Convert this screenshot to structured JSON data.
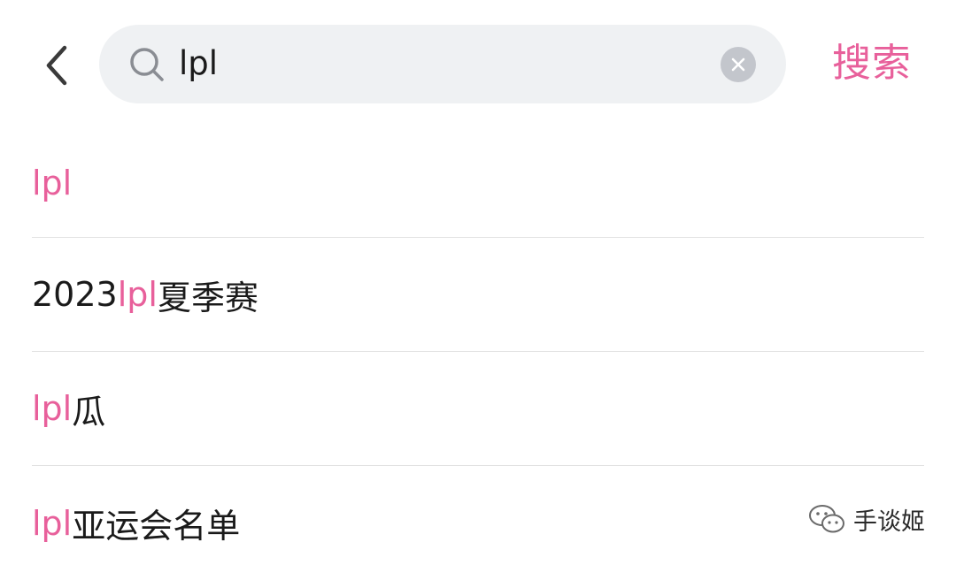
{
  "header": {
    "search_query": "lpl",
    "search_button_label": "搜索",
    "back_icon": "chevron-left-icon",
    "search_icon": "search-icon",
    "clear_icon": "close-circle-icon"
  },
  "suggestions": [
    {
      "prefix": "",
      "highlight": "lpl",
      "suffix": ""
    },
    {
      "prefix": "2023",
      "highlight": "lpl",
      "suffix": "夏季赛"
    },
    {
      "prefix": "",
      "highlight": "lpl",
      "suffix": "瓜"
    },
    {
      "prefix": "",
      "highlight": "lpl",
      "suffix": "亚运会名单"
    }
  ],
  "watermark": {
    "text": "手谈姬",
    "icon": "wechat-icon"
  },
  "colors": {
    "accent": "#e8609b",
    "search_box_bg": "#eff1f3",
    "divider": "#e2e2e2",
    "text": "#1a1a1a"
  }
}
